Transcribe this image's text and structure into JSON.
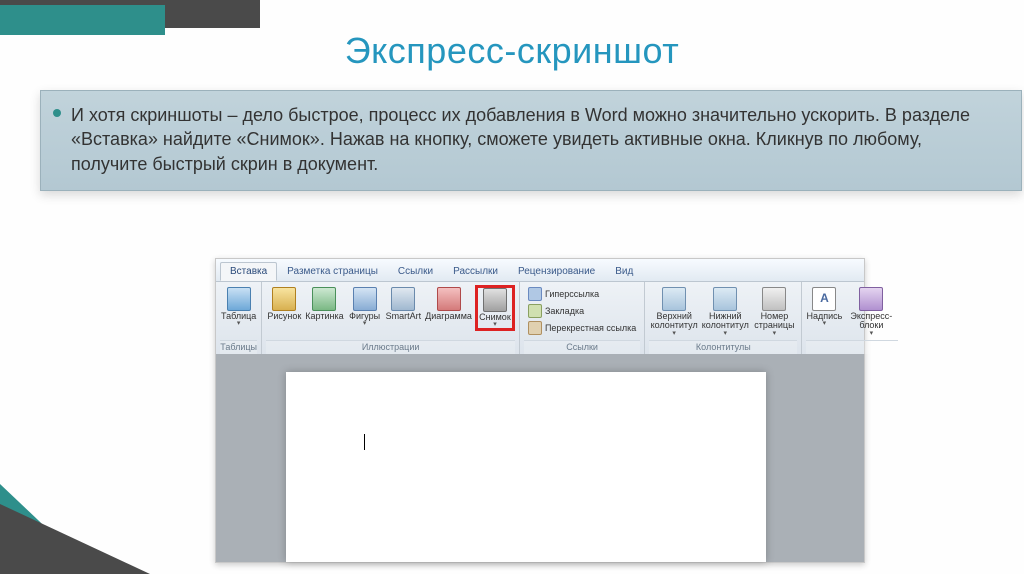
{
  "slide": {
    "title": "Экспресс-скриншот",
    "body_text": "И хотя скриншоты – дело быстрое, процесс их добавления в Word можно значительно ускорить. В разделе «Вставка» найдите «Снимок». Нажав на кнопку, сможете увидеть активные окна. Кликнув по любому, получите быстрый скрин в документ."
  },
  "ribbon": {
    "tabs": [
      "Вставка",
      "Разметка страницы",
      "Ссылки",
      "Рассылки",
      "Рецензирование",
      "Вид"
    ],
    "active_tab_index": 0,
    "groups": {
      "tables": {
        "label": "Таблицы",
        "buttons": {
          "table": "Таблица"
        }
      },
      "illustrations": {
        "label": "Иллюстрации",
        "buttons": {
          "picture": "Рисунок",
          "clipart": "Картинка",
          "shapes": "Фигуры",
          "smartart": "SmartArt",
          "chart": "Диаграмма",
          "screenshot": "Снимок"
        }
      },
      "links": {
        "label": "Ссылки",
        "items": {
          "hyperlink": "Гиперссылка",
          "bookmark": "Закладка",
          "crossref": "Перекрестная ссылка"
        }
      },
      "header_footer": {
        "label": "Колонтитулы",
        "buttons": {
          "header": "Верхний колонтитул",
          "footer": "Нижний колонтитул",
          "pagenum": "Номер страницы"
        }
      },
      "text": {
        "buttons": {
          "textbox": "Надпись",
          "quickparts": "Экспресс-блоки"
        }
      }
    }
  }
}
